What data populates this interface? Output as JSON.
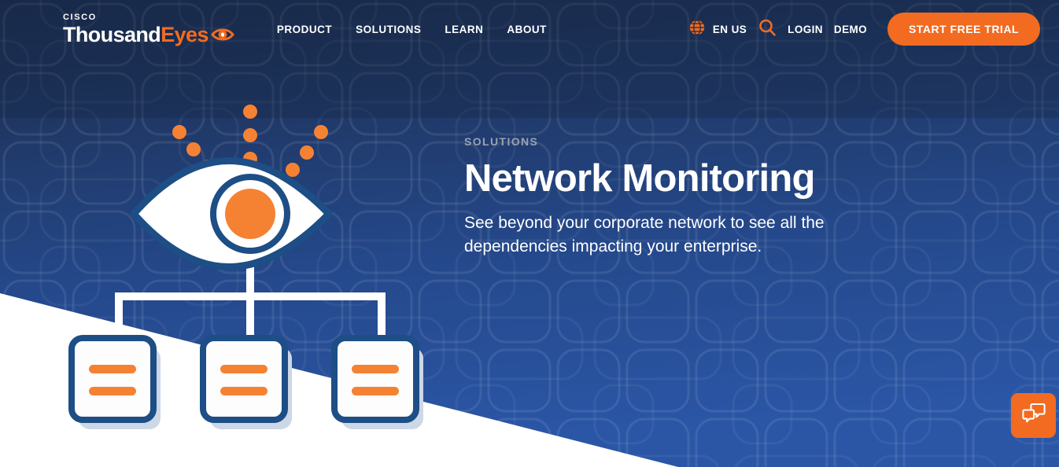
{
  "brand": {
    "cisco": "CISCO",
    "name_primary": "Thousand",
    "name_accent": "Eyes",
    "eye_logo_icon": "eye-icon",
    "colors": {
      "orange": "#f26b21",
      "deep_navy": "#1b2c4d",
      "mid_blue": "#2a55a3",
      "outline_blue": "#1d4e85",
      "white": "#ffffff",
      "eyebrow_gray": "#9aa3ae"
    }
  },
  "header": {
    "nav": [
      {
        "label": "PRODUCT"
      },
      {
        "label": "SOLUTIONS"
      },
      {
        "label": "LEARN"
      },
      {
        "label": "ABOUT"
      }
    ],
    "language": {
      "icon": "globe-icon",
      "label": "EN US"
    },
    "search": {
      "icon": "search-icon",
      "label": "Search"
    },
    "login_label": "LOGIN",
    "demo_label": "DEMO",
    "cta_label": "START FREE TRIAL"
  },
  "hero": {
    "eyebrow": "SOLUTIONS",
    "title": "Network Monitoring",
    "subtitle": "See beyond your corporate network to see all the dependencies impacting your enterprise."
  },
  "illustration": {
    "name": "network-monitoring-eye-diagram",
    "eye_icon": "eye-icon",
    "node_icon": "server-node-icon",
    "node_count": 3,
    "signal_dot_groups": 3,
    "signal_dots_per_group": 3
  },
  "chat": {
    "icon": "chat-bubbles-icon",
    "label": "Open chat"
  }
}
